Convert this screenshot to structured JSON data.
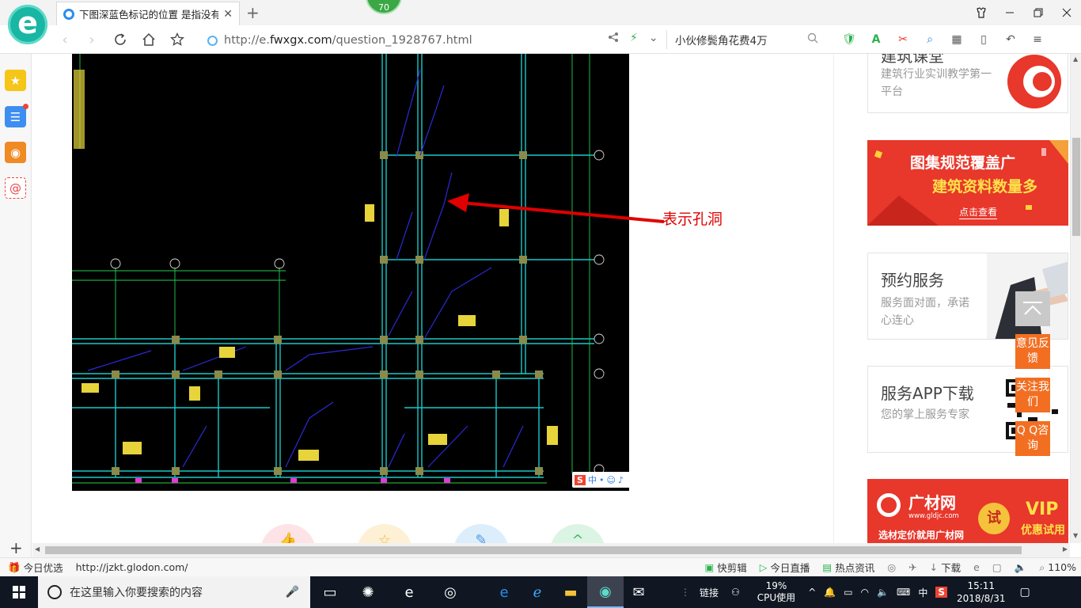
{
  "browser": {
    "tab_title": "下图深蓝色标记的位置 是指没有",
    "tab_close": "✕",
    "new_tab": "+",
    "badge": "70",
    "url_host": "http://e.",
    "url_host_bold": "fwxgx.com",
    "url_path": "/question_1928767.html",
    "search_text": "小伙修鬓角花费4万"
  },
  "content": {
    "annotation": "表示孔洞",
    "ime_label": "中"
  },
  "ads": {
    "card1_title": "建筑课堂",
    "card1_desc": "建筑行业实训教学第一平台",
    "banner1_line1": "图集规范覆盖广",
    "banner1_line2": "建筑资料数量多",
    "banner1_cta": "点击查看",
    "card2_title": "预约服务",
    "card2_desc": "服务面对面，承诺心连心",
    "card3_title": "服务APP下载",
    "card3_desc": "您的掌上服务专家",
    "banner2_brand": "广材网",
    "banner2_site": "www.gldjc.com",
    "banner2_tagline": "选材定价就用广材网",
    "banner2_try": "试",
    "banner2_vip": "VIP",
    "banner2_vip_sub": "优惠试用"
  },
  "floating": {
    "feedback": "意见反馈",
    "follow": "关注我们",
    "qq": "Q Q咨询"
  },
  "statusbar": {
    "today": "今日优选",
    "link_url": "http://jzkt.glodon.com/",
    "clip": "快剪辑",
    "live": "今日直播",
    "news": "热点资讯",
    "download": "下载",
    "zoom": "110%"
  },
  "taskbar": {
    "search_placeholder": "在这里输入你要搜索的内容",
    "links": "链接",
    "cpu_percent": "19%",
    "cpu_label": "CPU使用",
    "ime": "中",
    "time": "15:11",
    "date": "2018/8/31"
  },
  "colors": {
    "accent_orange": "#f26f22",
    "annotation_red": "#e00000",
    "cad_background": "#000000",
    "brand_teal": "#19b6a4"
  }
}
